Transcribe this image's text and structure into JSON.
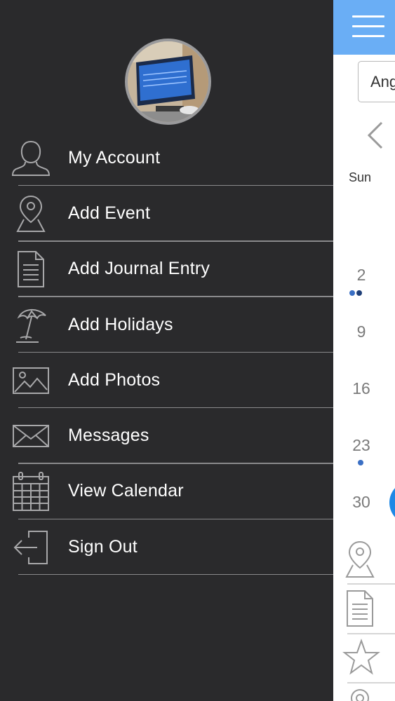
{
  "drawer": {
    "menu": [
      {
        "label": "My Account",
        "icon": "person-icon"
      },
      {
        "label": "Add Event",
        "icon": "map-pin-icon"
      },
      {
        "label": "Add Journal Entry",
        "icon": "document-icon"
      },
      {
        "label": "Add Holidays",
        "icon": "beach-umbrella-icon"
      },
      {
        "label": "Add Photos",
        "icon": "image-icon"
      },
      {
        "label": "Messages",
        "icon": "envelope-icon"
      },
      {
        "label": "View Calendar",
        "icon": "calendar-icon"
      },
      {
        "label": "Sign Out",
        "icon": "sign-out-icon"
      }
    ]
  },
  "content": {
    "select_value": "Ang",
    "weekday": "Sun",
    "days": [
      {
        "label": "2",
        "dots": [
          "#3a6fc4",
          "#1f3f78"
        ]
      },
      {
        "label": "9",
        "dots": []
      },
      {
        "label": "16",
        "dots": []
      },
      {
        "label": "23",
        "dots": [
          "#3a6fc4"
        ]
      },
      {
        "label": "30",
        "dots": []
      }
    ]
  },
  "colors": {
    "drawer_bg": "#2a2a2c",
    "topbar": "#6aaef5",
    "today_accent": "#1e88e5"
  }
}
